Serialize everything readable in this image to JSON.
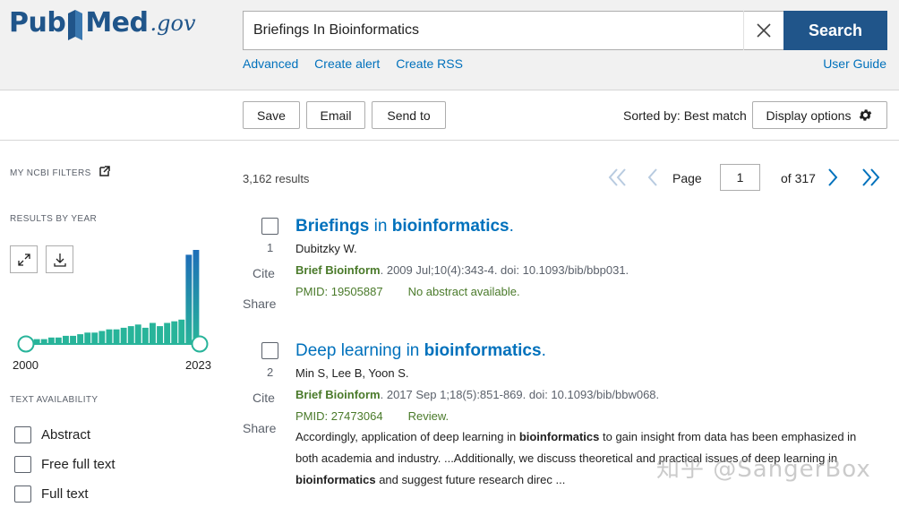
{
  "header": {
    "logo": {
      "pub": "Pub",
      "med": "Med",
      "gov": ".gov"
    },
    "search_value": "Briefings In Bioinformatics",
    "search_button": "Search",
    "links": [
      "Advanced",
      "Create alert",
      "Create RSS"
    ],
    "user_guide": "User Guide",
    "brand_color": "#20558a"
  },
  "toolbar": {
    "save": "Save",
    "email": "Email",
    "send_to": "Send to",
    "sorted": "Sorted by: Best match",
    "display_options": "Display options"
  },
  "sidebar": {
    "my_filters": "My NCBI Filters",
    "results_by_year": "Results by year",
    "year_start": "2000",
    "year_end": "2023",
    "year_counts": [
      3,
      3,
      3,
      4,
      4,
      5,
      5,
      6,
      7,
      7,
      8,
      9,
      9,
      10,
      11,
      12,
      10,
      13,
      11,
      13,
      14,
      15,
      55,
      58
    ],
    "text_availability": "Text availability",
    "filters": [
      "Abstract",
      "Free full text",
      "Full text"
    ]
  },
  "results": {
    "count": "3,162 results",
    "page_label": "Page",
    "page_value": "1",
    "of_pages": "of 317",
    "items": [
      {
        "num": "1",
        "title_parts": [
          {
            "t": "Briefings",
            "b": true
          },
          {
            "t": " in ",
            "b": false
          },
          {
            "t": "bioinformatics",
            "b": true
          },
          {
            "t": ".",
            "b": false
          }
        ],
        "authors": "Dubitzky W.",
        "journal": "Brief Bioinform",
        "citation": ". 2009 Jul;10(4):343-4. doi: 10.1093/bib/bbp031.",
        "pmid": "PMID: 19505887",
        "note": "No abstract available.",
        "cite": "Cite",
        "share": "Share"
      },
      {
        "num": "2",
        "title_parts": [
          {
            "t": "Deep learning in ",
            "b": false
          },
          {
            "t": "bioinformatics",
            "b": true
          },
          {
            "t": ".",
            "b": false
          }
        ],
        "authors": "Min S, Lee B, Yoon S.",
        "journal": "Brief Bioinform",
        "citation": ". 2017 Sep 1;18(5):851-869. doi: 10.1093/bib/bbw068.",
        "pmid": "PMID: 27473064",
        "note": "Review.",
        "cite": "Cite",
        "share": "Share",
        "snippet_parts": [
          {
            "t": "Accordingly, application of deep learning in ",
            "b": false
          },
          {
            "t": "bioinformatics",
            "b": true
          },
          {
            "t": " to gain insight from data has been emphasized in both academia and industry. ...Additionally, we discuss theoretical and practical issues of deep learning in ",
            "b": false
          },
          {
            "t": "bioinformatics",
            "b": true
          },
          {
            "t": " and suggest future research direc ...",
            "b": false
          }
        ]
      }
    ]
  },
  "watermark": "知乎 @SangerBox"
}
